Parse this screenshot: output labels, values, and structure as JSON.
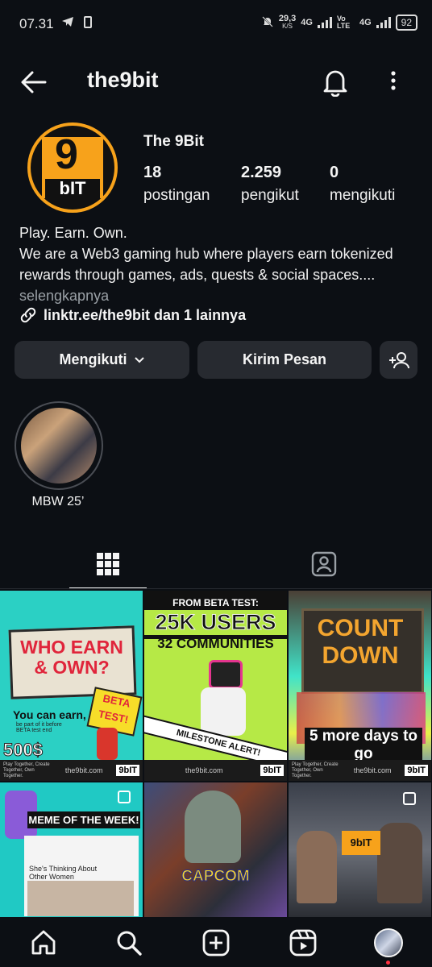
{
  "status_bar": {
    "time": "07.31",
    "speed": "29,3",
    "speed_unit": "K/S",
    "net1": "4G",
    "volte": "Vo LTE",
    "net2": "4G",
    "battery": "92"
  },
  "header": {
    "username": "the9bit"
  },
  "profile": {
    "display_name": "The 9Bit",
    "stats": [
      {
        "value": "18",
        "label": "postingan"
      },
      {
        "value": "2.259",
        "label": "pengikut"
      },
      {
        "value": "0",
        "label": "mengikuti"
      }
    ],
    "bio_line1": "Play. Earn. Own.",
    "bio_line2": "We are a Web3 gaming hub where players earn tokenized rewards through games, ads, quests & social spaces....",
    "bio_more": "selengkapnya",
    "link": "linktr.ee/the9bit dan 1 lainnya",
    "avatar_logo_top": "9",
    "avatar_logo_bottom": "bIT"
  },
  "actions": {
    "following": "Mengikuti",
    "message": "Kirim Pesan"
  },
  "highlight": {
    "label": "MBW 25’"
  },
  "posts": [
    {
      "headline": "WHO EARN & OWN?",
      "sub": "You can earn,",
      "sub2": "be part of it before BETA test end",
      "badge": "BETA TEST!",
      "amount": "500$",
      "footer_left": "Play Together, Create Together, Own Together.",
      "footer_site": "the9bit.com"
    },
    {
      "headline_small": "FROM BETA TEST:",
      "headline": "25K USERS",
      "sub": "32 COMMUNITIES",
      "tape": "MILESTONE ALERT!",
      "footer_site": "the9bit.com"
    },
    {
      "headline": "COUNT DOWN",
      "sub": "5 more days to go",
      "footer_left": "Play Together, Create Together, Own Together.",
      "footer_site": "the9bit.com"
    },
    {
      "headline": "MEME OF THE WEEK!",
      "sub": "She's Thinking About Other Women"
    },
    {
      "headline": "CAPCOM"
    },
    {
      "logo": "9bIT"
    }
  ]
}
